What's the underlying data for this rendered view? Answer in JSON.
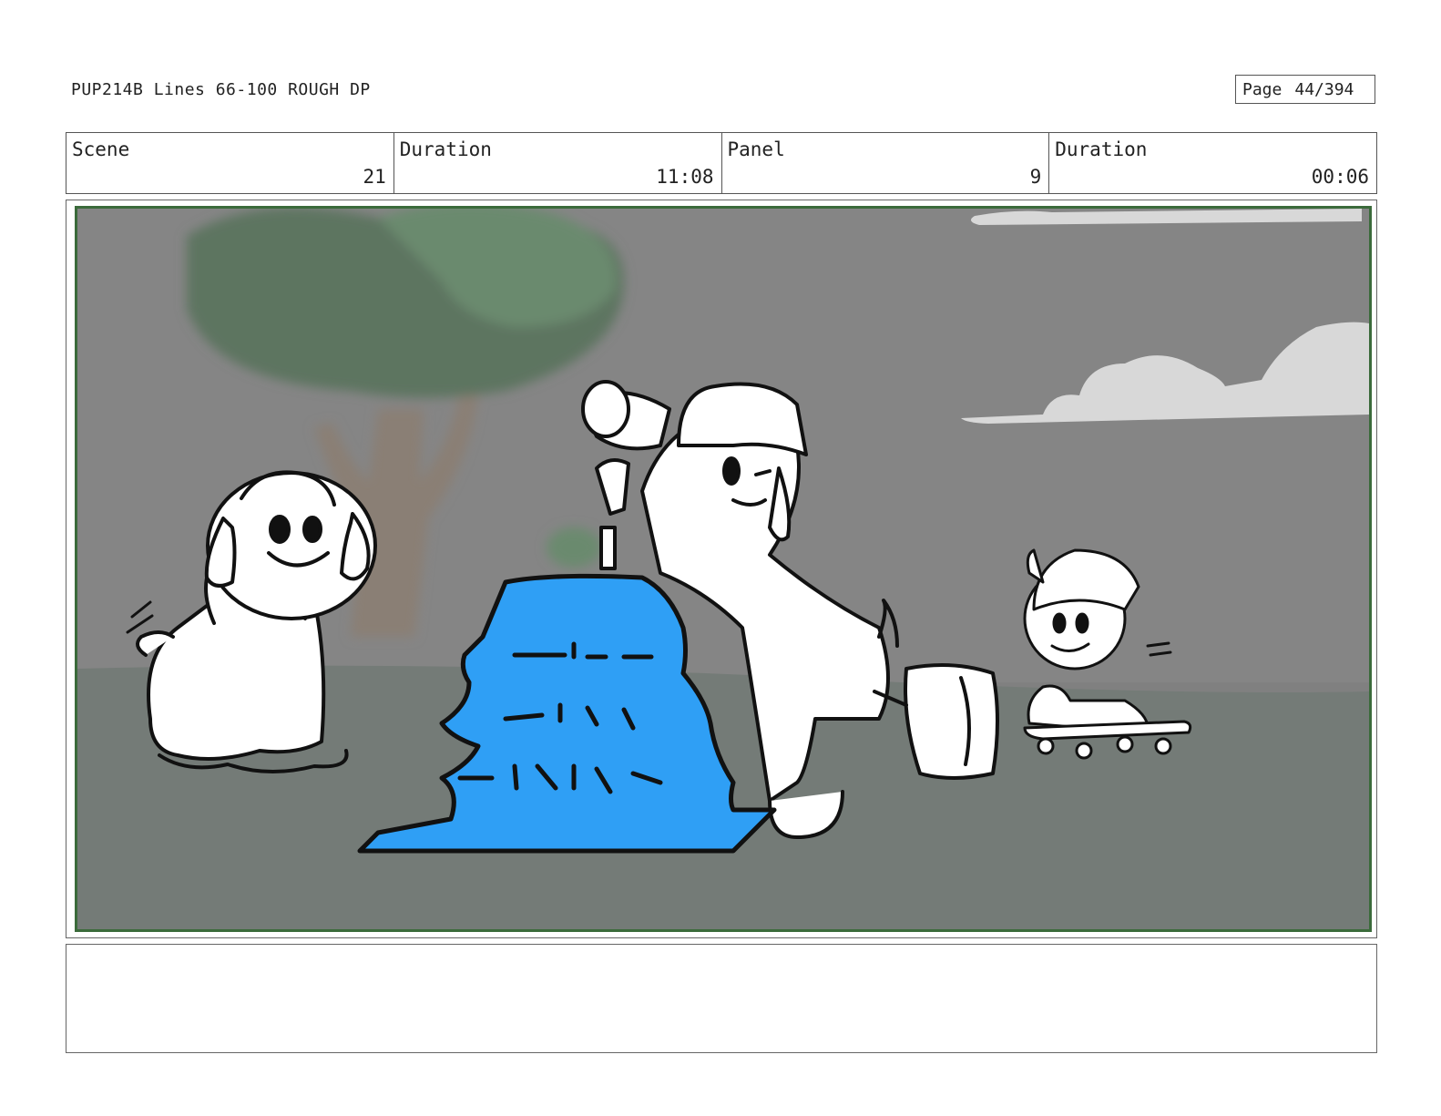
{
  "header": {
    "title": "PUP214B Lines 66-100 ROUGH DP",
    "page_label": "Page",
    "page_value": "44/394"
  },
  "info": {
    "scene_label": "Scene",
    "scene_value": "21",
    "scene_duration_label": "Duration",
    "scene_duration_value": "11:08",
    "panel_label": "Panel",
    "panel_value": "9",
    "panel_duration_label": "Duration",
    "panel_duration_value": "00:06"
  },
  "colors": {
    "frame_border": "#3b6b3b",
    "sky": "#858585",
    "ground": "#747b77",
    "tree_foliage": "#5d7560",
    "tree_trunk": "#8a7f75",
    "cloud": "#d8d8d8",
    "tree_prop_blue": "#2f9ff5"
  },
  "notes": {
    "text": ""
  }
}
